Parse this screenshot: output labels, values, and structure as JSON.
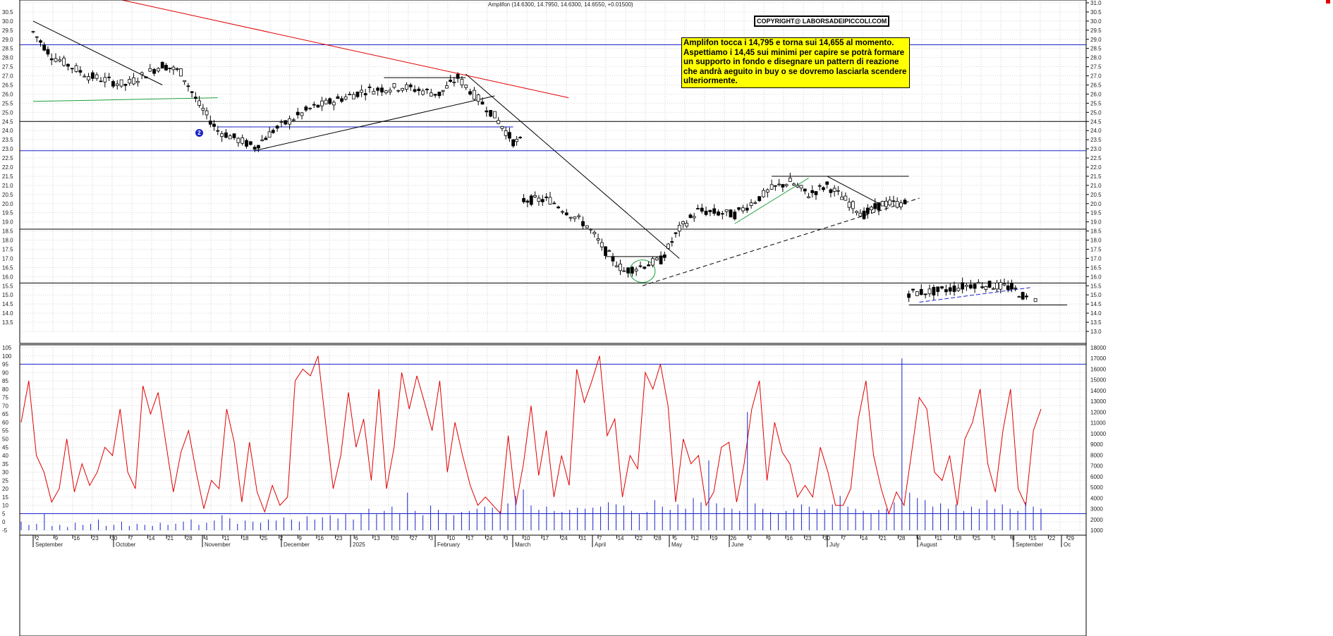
{
  "header": {
    "quote": "Amplifon (14.6300, 14.7950, 14.6300, 14.6550, +0.01500)"
  },
  "copyright": "COPYRIGHT@ LABORSADEIPICCOLI.COM",
  "note": "Amplifon tocca i 14,795 e torna sui 14,655 al momento. Aspettiamo i 14,45 sui minimi per capire se potrà formare un supporto in fondo e disegnare un pattern di reazione che andrà aeguito in buy o se dovremo lasciarla scendere ulteriormente.",
  "marker": "2",
  "colors": {
    "price_line": "#000000",
    "oscillator": "#e00000",
    "volume": "#1a24c9",
    "level_blue": "#1a24c9",
    "trend_red": "#e00000",
    "trend_green": "#1e9e3a"
  },
  "chart_data": [
    {
      "type": "candlestick",
      "title": "Amplifon",
      "y_axis": {
        "side": "right",
        "range": [
          13.0,
          31.0
        ],
        "tick_step": 0.5
      },
      "grid": true,
      "x_months": [
        "September",
        "October",
        "November",
        "December",
        "2025",
        "February",
        "March",
        "April",
        "May",
        "June",
        "July",
        "August",
        "September",
        "Oc"
      ],
      "x_days": [
        "2",
        "9",
        "16",
        "23",
        "30",
        "7",
        "14",
        "21",
        "28",
        "4",
        "11",
        "18",
        "25",
        "2",
        "9",
        "16",
        "23",
        "6",
        "13",
        "20",
        "27",
        "3",
        "10",
        "17",
        "24",
        "3",
        "10",
        "17",
        "24",
        "31",
        "7",
        "14",
        "22",
        "28",
        "5",
        "12",
        "19",
        "26",
        "2",
        "9",
        "16",
        "23",
        "30",
        "7",
        "14",
        "21",
        "28",
        "4",
        "11",
        "18",
        "25",
        "1",
        "8",
        "15",
        "22",
        "29"
      ],
      "horizontal_levels": [
        {
          "value": 28.7,
          "color": "blue"
        },
        {
          "value": 24.5,
          "color": "black"
        },
        {
          "value": 22.9,
          "color": "blue"
        },
        {
          "value": 18.6,
          "color": "black"
        },
        {
          "value": 15.65,
          "color": "black"
        }
      ],
      "last_close": 14.655,
      "points": [
        {
          "date": "2024-09-02",
          "close": 29.4
        },
        {
          "date": "2024-09-09",
          "close": 28.1
        },
        {
          "date": "2024-09-23",
          "close": 27.0
        },
        {
          "date": "2024-10-07",
          "close": 26.5
        },
        {
          "date": "2024-10-21",
          "close": 27.6
        },
        {
          "date": "2024-10-28",
          "close": 27.2
        },
        {
          "date": "2024-11-04",
          "close": 25.4
        },
        {
          "date": "2024-11-11",
          "close": 24.0
        },
        {
          "date": "2024-11-25",
          "close": 23.1
        },
        {
          "date": "2024-12-02",
          "close": 24.0
        },
        {
          "date": "2024-12-16",
          "close": 25.2
        },
        {
          "date": "2025-01-06",
          "close": 26.2
        },
        {
          "date": "2025-01-20",
          "close": 26.4
        },
        {
          "date": "2025-02-03",
          "close": 26.0
        },
        {
          "date": "2025-02-10",
          "close": 26.9
        },
        {
          "date": "2025-02-24",
          "close": 24.8
        },
        {
          "date": "2025-03-03",
          "close": 23.4
        },
        {
          "date": "2025-03-07",
          "close": 20.2
        },
        {
          "date": "2025-03-17",
          "close": 20.2
        },
        {
          "date": "2025-03-31",
          "close": 18.8
        },
        {
          "date": "2025-04-07",
          "close": 17.4
        },
        {
          "date": "2025-04-14",
          "close": 16.3
        },
        {
          "date": "2025-04-28",
          "close": 16.9
        },
        {
          "date": "2025-05-05",
          "close": 18.6
        },
        {
          "date": "2025-05-12",
          "close": 19.6
        },
        {
          "date": "2025-05-26",
          "close": 19.4
        },
        {
          "date": "2025-06-09",
          "close": 20.8
        },
        {
          "date": "2025-06-16",
          "close": 21.2
        },
        {
          "date": "2025-06-23",
          "close": 20.5
        },
        {
          "date": "2025-06-30",
          "close": 21.0
        },
        {
          "date": "2025-07-07",
          "close": 20.2
        },
        {
          "date": "2025-07-14",
          "close": 19.4
        },
        {
          "date": "2025-07-21",
          "close": 20.0
        },
        {
          "date": "2025-07-28",
          "close": 20.0
        },
        {
          "date": "2025-07-31",
          "close": 15.1
        },
        {
          "date": "2025-08-11",
          "close": 15.2
        },
        {
          "date": "2025-08-25",
          "close": 15.6
        },
        {
          "date": "2025-09-01",
          "close": 15.5
        },
        {
          "date": "2025-09-08",
          "close": 15.4
        },
        {
          "date": "2025-09-15",
          "close": 14.655
        }
      ]
    },
    {
      "type": "line",
      "title": "",
      "y_axis": {
        "side": "left",
        "range": [
          -5,
          105
        ],
        "tick_step": 5
      },
      "horizontal_levels": [
        95,
        5
      ],
      "series": [
        {
          "values": [
            60,
            85,
            40,
            30,
            12,
            20,
            50,
            18,
            35,
            22,
            30,
            45,
            40,
            68,
            30,
            20,
            82,
            65,
            78,
            48,
            18,
            42,
            55,
            30,
            8,
            25,
            20,
            68,
            48,
            12,
            48,
            18,
            6,
            22,
            10,
            15,
            85,
            92,
            88,
            100,
            60,
            20,
            40,
            78,
            45,
            62,
            25,
            80,
            20,
            45,
            90,
            68,
            88,
            72,
            55,
            85,
            30,
            60,
            40,
            22,
            10,
            15,
            10,
            5,
            52,
            10,
            35,
            70,
            28,
            55,
            15,
            40,
            22,
            92,
            72,
            85,
            100,
            52,
            62,
            15,
            40,
            32,
            90,
            80,
            95,
            70,
            12,
            50,
            35,
            40,
            10,
            18,
            45,
            48,
            12,
            35,
            68,
            85,
            25,
            60,
            42,
            35,
            15,
            22,
            15,
            45,
            30,
            10,
            10,
            20,
            62,
            85,
            40,
            20,
            5,
            18,
            10,
            42,
            75,
            68,
            30,
            25,
            40,
            10,
            50,
            60,
            80,
            35,
            18,
            55,
            80,
            20,
            10,
            55,
            68
          ]
        }
      ]
    },
    {
      "type": "bar",
      "title": "",
      "y_axis": {
        "side": "right",
        "range": [
          1000,
          18000
        ],
        "tick_step": 1000
      },
      "series": [
        {
          "values": [
            1800,
            1500,
            1600,
            2500,
            1400,
            1500,
            1300,
            1700,
            1500,
            1600,
            2000,
            1400,
            1500,
            1800,
            1400,
            1600,
            1500,
            1400,
            1700,
            1500,
            1600,
            1800,
            2000,
            1500,
            1700,
            1900,
            2400,
            2100,
            1600,
            1900,
            1800,
            1700,
            2000,
            1900,
            2200,
            2000,
            1800,
            2300,
            2000,
            2200,
            2400,
            2100,
            2500,
            2000,
            2600,
            3000,
            2500,
            2800,
            3200,
            2600,
            4500,
            2800,
            2400,
            3300,
            2900,
            2600,
            2400,
            2700,
            2800,
            3000,
            3200,
            3100,
            2800,
            3500,
            4200,
            4800,
            3300,
            2900,
            3200,
            2800,
            2700,
            2900,
            3100,
            3000,
            3100,
            3200,
            3600,
            3400,
            3300,
            2800,
            2500,
            2700,
            3800,
            3200,
            2900,
            3400,
            3000,
            4000,
            3600,
            7500,
            3500,
            3100,
            3000,
            2800,
            12000,
            3500,
            3000,
            2700,
            2600,
            2800,
            3000,
            3400,
            3200,
            3000,
            2900,
            3400,
            4200,
            3200,
            3000,
            2800,
            2600,
            2900,
            3000,
            3600,
            17000,
            4500,
            4000,
            3800,
            3200,
            3500,
            3000,
            3400,
            2800,
            3200,
            3000,
            3800,
            3000,
            3400,
            3000,
            2800,
            3600,
            3200,
            3000
          ]
        }
      ]
    }
  ]
}
